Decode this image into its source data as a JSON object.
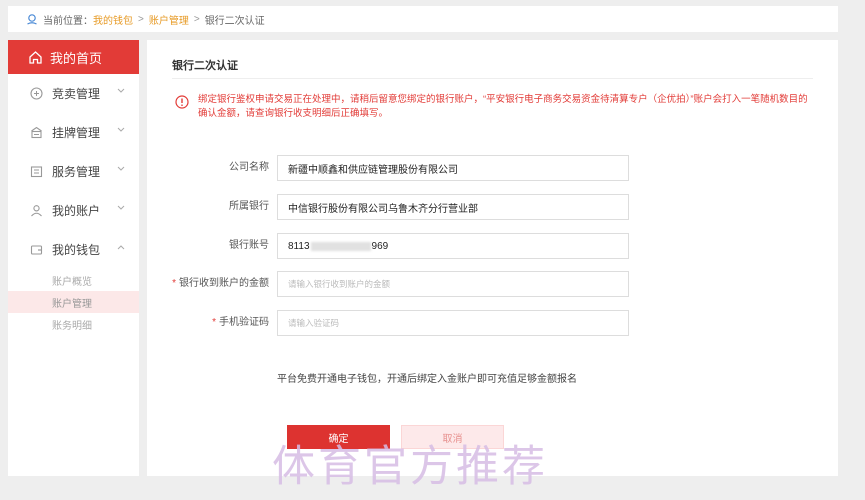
{
  "breadcrumb": {
    "prefix": "当前位置：",
    "items": [
      "我的钱包",
      "账户管理",
      "银行二次认证"
    ],
    "sep": ">"
  },
  "sidebar": {
    "home": "我的首页",
    "items": [
      {
        "label": "竞卖管理"
      },
      {
        "label": "挂牌管理"
      },
      {
        "label": "服务管理"
      },
      {
        "label": "我的账户"
      },
      {
        "label": "我的钱包"
      }
    ],
    "sub_items": [
      "账户概览",
      "账户管理",
      "账务明细"
    ]
  },
  "main": {
    "title": "银行二次认证",
    "notice": "绑定银行鉴权申请交易正在处理中，请稍后留意您绑定的银行账户，“平安银行电子商务交易资金待清算专户（企优拍）”账户会打入一笔随机数目的确认金额，请查询银行收支明细后正确填写。",
    "fields": {
      "company_label": "公司名称",
      "company_value": "新疆中顺鑫和供应链管理股份有限公司",
      "bank_label": "所属银行",
      "bank_value": "中信银行股份有限公司乌鲁木齐分行营业部",
      "account_label": "银行账号",
      "account_prefix": "8113",
      "account_suffix": "969",
      "amount_required": "*",
      "amount_label": "银行收到账户的金额",
      "amount_placeholder": "请输入银行收到账户的金额",
      "sms_required": "*",
      "sms_label": "手机验证码",
      "sms_placeholder": "请输入验证码"
    },
    "tip": "平台免费开通电子钱包，开通后绑定入金账户即可充值足够金额报名",
    "confirm": "确定",
    "cancel": "取消"
  },
  "watermark": "体育官方推荐",
  "colors": {
    "accent": "#e23b37",
    "breadcrumb_highlight": "#e79b27",
    "background": "#eeeeee"
  }
}
